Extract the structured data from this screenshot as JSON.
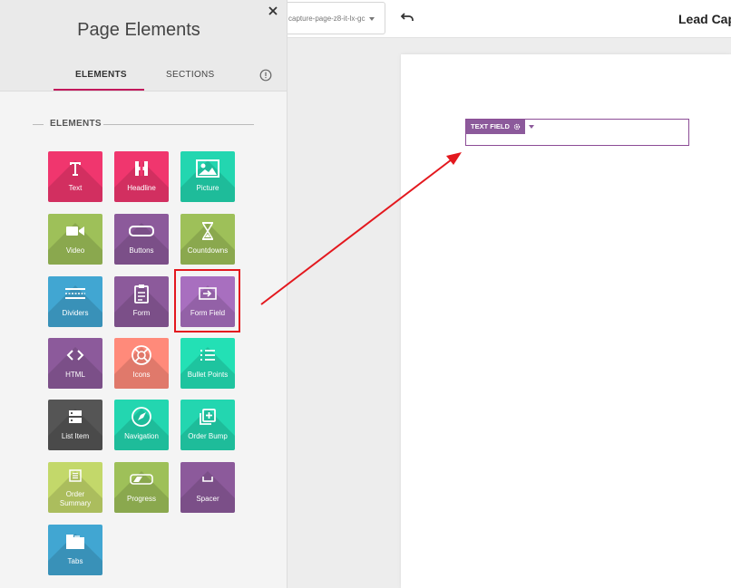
{
  "panel": {
    "title": "Page Elements",
    "tabs": [
      {
        "label": "ELEMENTS",
        "active": true
      },
      {
        "label": "SECTIONS",
        "active": false
      }
    ],
    "section_heading": "ELEMENTS",
    "elements": [
      {
        "label": "Text",
        "icon": "text-icon",
        "color": "#f0366e"
      },
      {
        "label": "Headline",
        "icon": "headline-icon",
        "color": "#f0366e"
      },
      {
        "label": "Picture",
        "icon": "picture-icon",
        "color": "#23d6b0"
      },
      {
        "label": "Video",
        "icon": "video-icon",
        "color": "#9ec059"
      },
      {
        "label": "Buttons",
        "icon": "buttons-icon",
        "color": "#8c5a9b"
      },
      {
        "label": "Countdowns",
        "icon": "hourglass-icon",
        "color": "#9ec059"
      },
      {
        "label": "Dividers",
        "icon": "dividers-icon",
        "color": "#41a6d2"
      },
      {
        "label": "Form",
        "icon": "form-icon",
        "color": "#8c5a9b"
      },
      {
        "label": "Form Field",
        "icon": "form-field-icon",
        "color": "#a86fbf"
      },
      {
        "label": "HTML",
        "icon": "code-icon",
        "color": "#8c5a9b"
      },
      {
        "label": "Icons",
        "icon": "icons-icon",
        "color": "#ff8a7a"
      },
      {
        "label": "Bullet Points",
        "icon": "list-icon",
        "color": "#23e0b5"
      },
      {
        "label": "List Item",
        "icon": "list-item-icon",
        "color": "#555555"
      },
      {
        "label": "Navigation",
        "icon": "navigation-icon",
        "color": "#23d6b0"
      },
      {
        "label": "Order Bump",
        "icon": "order-bump-icon",
        "color": "#23d6b0"
      },
      {
        "label": "Order Summary",
        "icon": "order-summary-icon",
        "color": "#c3d86a"
      },
      {
        "label": "Progress",
        "icon": "progress-icon",
        "color": "#9ec059"
      },
      {
        "label": "Spacer",
        "icon": "spacer-icon",
        "color": "#8c5a9b"
      },
      {
        "label": "Tabs",
        "icon": "tabs-icon",
        "color": "#41a6d2"
      }
    ]
  },
  "topbar": {
    "url_value": "capture-page-z8-it-lx-gc",
    "page_title": "Lead Cap"
  },
  "canvas": {
    "widget_label": "TEXT FIELD"
  },
  "colors": {
    "accent": "#c2185b",
    "highlight": "#e3181e",
    "widget": "#8c5a9b"
  }
}
